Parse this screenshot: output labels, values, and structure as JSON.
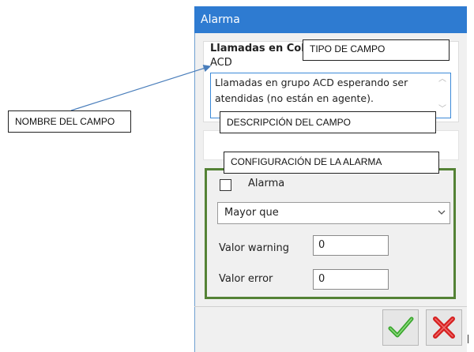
{
  "window": {
    "title": "Alarma"
  },
  "field": {
    "name": "Llamadas en Cola",
    "type": "ACD",
    "description": "Llamadas en grupo ACD esperando ser atendidas (no están en agente)."
  },
  "alarm": {
    "checkbox_label": "Alarma",
    "checked": false,
    "condition_selected": "Mayor que",
    "warning_label": "Valor warning",
    "warning_value": "0",
    "error_label": "Valor error",
    "error_value": "0"
  },
  "buttons": {
    "ok_icon": "check-icon",
    "cancel_icon": "x-icon"
  },
  "annotations": {
    "tipo_de_campo": "TIPO DE CAMPO",
    "nombre_del_campo": "NOMBRE DEL CAMPO",
    "descripcion_del_campo": "DESCRIPCIÓN DEL CAMPO",
    "configuracion_alarma": "CONFIGURACIÓN DE LA ALARMA"
  },
  "colors": {
    "titlebar": "#2e7bd1",
    "alarm_border": "#548235",
    "description_border": "#3c8ad8",
    "ok_check": "#3aa62e",
    "cancel_x": "#d62020"
  }
}
